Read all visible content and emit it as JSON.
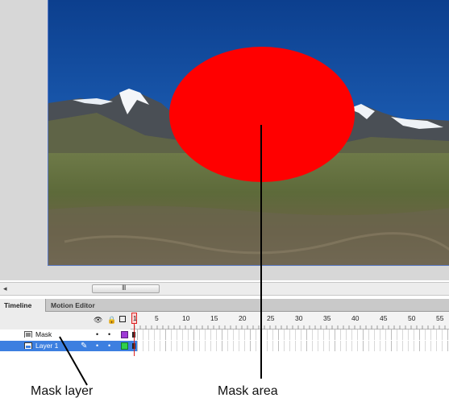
{
  "scrollbar": {
    "grip": "III"
  },
  "tabs": {
    "timeline": "Timeline",
    "motion_editor": "Motion Editor"
  },
  "timeline": {
    "ruler_numbers": [
      "1",
      "5",
      "10",
      "15",
      "20",
      "25",
      "30",
      "35",
      "40",
      "45",
      "50",
      "55"
    ],
    "layers": [
      {
        "name": "Mask",
        "color": "#9f3ad6",
        "selected": false
      },
      {
        "name": "Layer 1",
        "color": "#2fd04a",
        "selected": true
      }
    ]
  },
  "stage": {
    "mask_color": "#ff0000"
  },
  "annotations": {
    "mask_area": "Mask area",
    "mask_layer": "Mask layer"
  }
}
